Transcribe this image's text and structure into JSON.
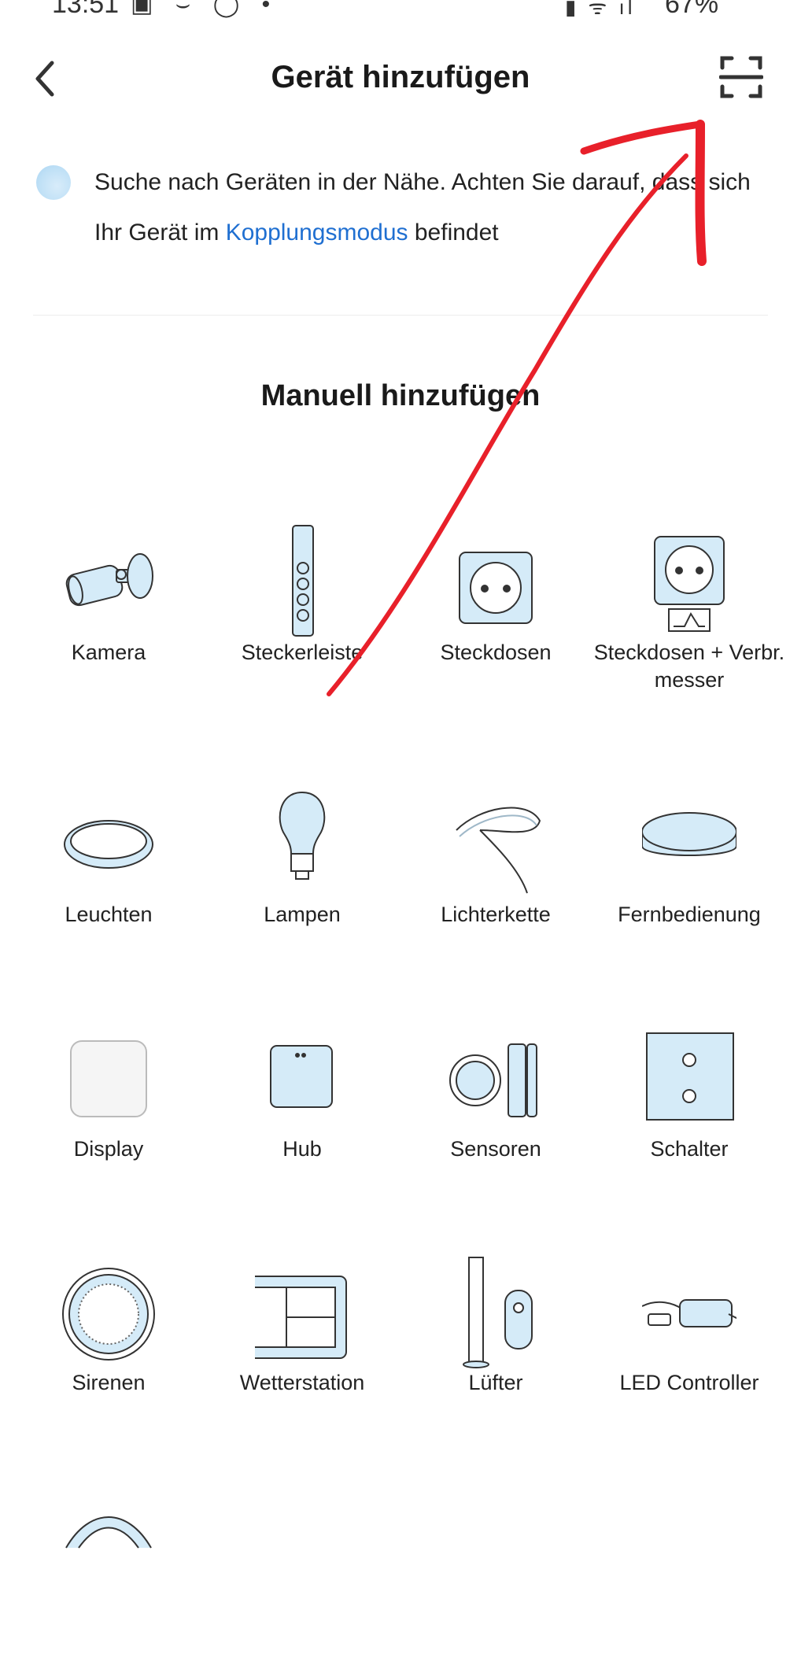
{
  "status_bar": {
    "time": "13:51",
    "left_icons": "▣ ⌣ ◯ •",
    "right_icons": "▮ ᯤ ıl",
    "battery": "67%"
  },
  "header": {
    "title": "Gerät hinzufügen"
  },
  "search": {
    "text_before": "Suche nach Geräten in der Nähe. Achten Sie darauf, dass sich Ihr Gerät im ",
    "link": "Kopplungsmodus",
    "text_after": " befindet"
  },
  "manual": {
    "title": "Manuell hinzufügen",
    "devices": [
      {
        "label": "Kamera"
      },
      {
        "label": "Steckerleiste"
      },
      {
        "label": "Steckdosen"
      },
      {
        "label": "Steckdosen + Verbr. messer"
      },
      {
        "label": "Leuchten"
      },
      {
        "label": "Lampen"
      },
      {
        "label": "Lichterkette"
      },
      {
        "label": "Fernbedienung"
      },
      {
        "label": "Display"
      },
      {
        "label": "Hub"
      },
      {
        "label": "Sensoren"
      },
      {
        "label": "Schalter"
      },
      {
        "label": "Sirenen"
      },
      {
        "label": "Wetterstation"
      },
      {
        "label": "Lüfter"
      },
      {
        "label": "LED Controller"
      }
    ]
  },
  "colors": {
    "accent_link": "#1f6fd1",
    "icon_fill": "#d5ebf8",
    "annotation_red": "#e8202a"
  }
}
